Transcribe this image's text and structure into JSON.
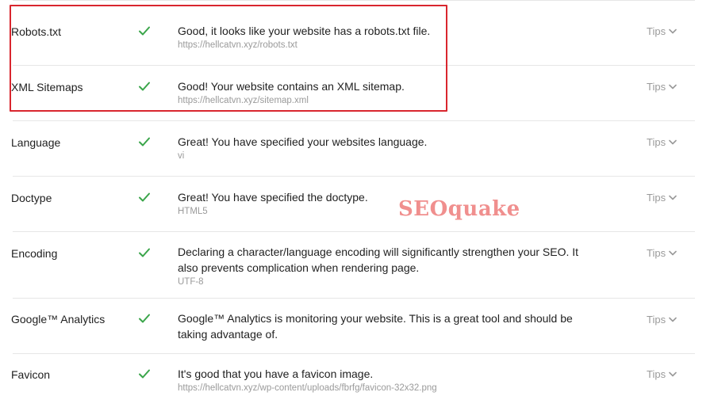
{
  "rows": [
    {
      "name": "Robots.txt",
      "status": "pass",
      "message": "Good, it looks like your website has a robots.txt file.",
      "detail": "https://hellcatvn.xyz/robots.txt",
      "tips": "Tips"
    },
    {
      "name": "XML Sitemaps",
      "status": "pass",
      "message": "Good! Your website contains an XML sitemap.",
      "detail": "https://hellcatvn.xyz/sitemap.xml",
      "tips": "Tips"
    },
    {
      "name": "Language",
      "status": "pass",
      "message": "Great! You have specified your websites language.",
      "detail": "vi",
      "tips": "Tips"
    },
    {
      "name": "Doctype",
      "status": "pass",
      "message": "Great! You have specified the doctype.",
      "detail": "HTML5",
      "tips": "Tips"
    },
    {
      "name": "Encoding",
      "status": "pass",
      "message": "Declaring a character/language encoding will significantly strengthen your SEO. It also prevents complication when rendering page.",
      "detail": "UTF-8",
      "tips": "Tips"
    },
    {
      "name": "Google™ Analytics",
      "status": "pass",
      "message": "Google™ Analytics is monitoring your website. This is a great tool and should be taking advantage of.",
      "detail": "",
      "tips": "Tips"
    },
    {
      "name": "Favicon",
      "status": "pass",
      "message": "It's good that you have a favicon image.",
      "detail": "https://hellcatvn.xyz/wp-content/uploads/fbrfg/favicon-32x32.png",
      "tips": "Tips"
    }
  ],
  "watermark": "SEOquake",
  "colors": {
    "check": "#3aa54a",
    "highlight": "#d9262e",
    "watermark": "#f08a88"
  },
  "icons": {
    "status": "check-icon",
    "tips": "chevron-down-icon"
  }
}
